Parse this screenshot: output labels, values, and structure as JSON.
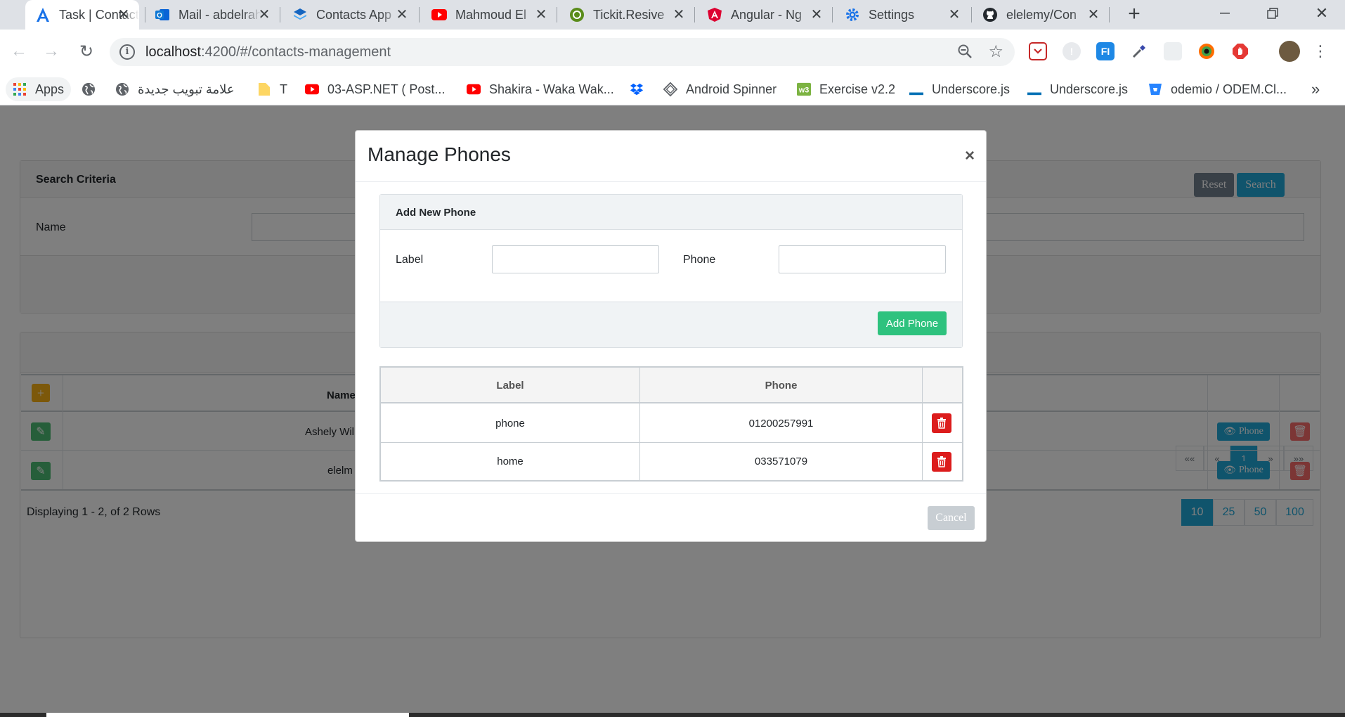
{
  "browser": {
    "tabs": [
      {
        "title": "Task | Contacts",
        "icon": "angular-a-icon",
        "active": true
      },
      {
        "title": "Mail - abdelrahman",
        "icon": "outlook-icon"
      },
      {
        "title": "Contacts App",
        "icon": "layers-icon"
      },
      {
        "title": "Mahmoud El",
        "icon": "youtube-icon"
      },
      {
        "title": "Tickit.Resive",
        "icon": "tickit-icon"
      },
      {
        "title": "Angular - Ng",
        "icon": "angular-shield-icon"
      },
      {
        "title": "Settings",
        "icon": "gear-icon"
      },
      {
        "title": "elelemy/Con",
        "icon": "github-icon"
      }
    ],
    "url_host": "localhost",
    "url_path": ":4200/#/contacts-management",
    "bookmarks": [
      {
        "label": "Apps",
        "icon": "apps-grid-icon"
      },
      {
        "label": "",
        "icon": "globe-icon"
      },
      {
        "label": "علامة تبويب جديدة",
        "icon": "globe-icon"
      },
      {
        "label": "T",
        "icon": "folder-icon"
      },
      {
        "label": "03-ASP.NET ( Post...",
        "icon": "youtube-icon"
      },
      {
        "label": "Shakira - Waka Wak...",
        "icon": "youtube-icon"
      },
      {
        "label": "",
        "icon": "dropbox-icon"
      },
      {
        "label": "Android Spinner",
        "icon": "diamond-icon"
      },
      {
        "label": "Exercise v2.2",
        "icon": "w3-icon"
      },
      {
        "label": "Underscore.js",
        "icon": "underscore-icon"
      },
      {
        "label": "Underscore.js",
        "icon": "underscore-icon"
      },
      {
        "label": "odemio / ODEM.Cl...",
        "icon": "bitbucket-icon"
      }
    ],
    "bookmarks_overflow": "»"
  },
  "background_page": {
    "search_title": "Search Criteria",
    "name_label": "Name",
    "reset_label": "Reset",
    "search_label": "Search",
    "pager": [
      "««",
      "«",
      "1",
      "»",
      "»»"
    ],
    "name_header": "Name",
    "rows": [
      {
        "name": "Ashely Wil",
        "phone_btn": "Phone"
      },
      {
        "name": "elelm",
        "phone_btn": "Phone"
      }
    ],
    "displaying": "Displaying 1 - 2, of 2 Rows",
    "page_sizes": [
      "10",
      "25",
      "50",
      "100"
    ]
  },
  "modal": {
    "title": "Manage Phones",
    "close": "×",
    "add_card_title": "Add New Phone",
    "label_field": "Label",
    "phone_field": "Phone",
    "label_value": "",
    "phone_value": "",
    "add_button": "Add Phone",
    "table_headers": [
      "Label",
      "Phone",
      ""
    ],
    "phones": [
      {
        "label": "phone",
        "phone": "01200257991"
      },
      {
        "label": "home",
        "phone": "033571079"
      }
    ],
    "cancel_button": "Cancel"
  },
  "colors": {
    "primary": "#20a8d8",
    "success": "#4dbd74",
    "danger": "#dc1c1c",
    "warning": "#ffc107",
    "secondary": "#c8ced3"
  }
}
